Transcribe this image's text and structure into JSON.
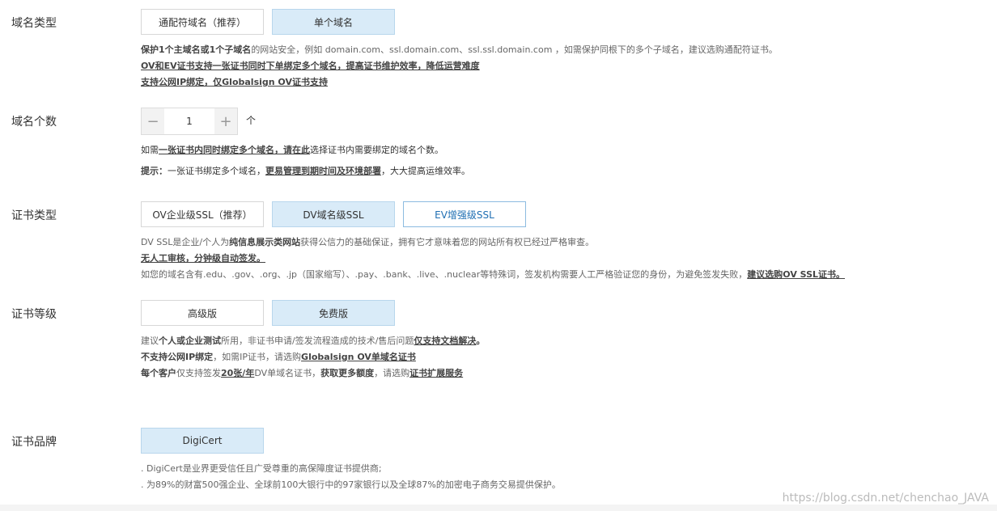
{
  "domain_type": {
    "label": "域名类型",
    "options": [
      "通配符域名（推荐）",
      "单个域名"
    ],
    "selected": "单个域名",
    "desc": {
      "line1_b1": "保护1个主域名或1个子域名",
      "line1_rest": "的网站安全，例如 domain.com、ssl.domain.com、ssl.ssl.domain.com ，如需保护同根下的多个子域名，建议选购通配符证书。",
      "line2": "OV和EV证书支持一张证书同时下单绑定多个域名，提高证书维护效率，降低运营难度",
      "line3": "支持公网IP绑定，仅Globalsign OV证书支持"
    }
  },
  "domain_count": {
    "label": "域名个数",
    "minus": "−",
    "value": "1",
    "plus": "+",
    "unit": "个",
    "desc": {
      "line1_pre": "如需",
      "line1_link": "一张证书内同时绑定多个域名，请在此",
      "line1_post": "选择证书内需要绑定的域名个数。",
      "line2_b": "提示：",
      "line2_mid": "一张证书绑定多个域名，",
      "line2_link": "更易管理到期时间及环境部署",
      "line2_post": "，大大提高运维效率。"
    }
  },
  "cert_type": {
    "label": "证书类型",
    "options": [
      "OV企业级SSL（推荐）",
      "DV域名级SSL",
      "EV增强级SSL"
    ],
    "selected": "DV域名级SSL",
    "desc": {
      "line1_pre": "DV SSL是企业/个人为",
      "line1_b": "纯信息展示类网站",
      "line1_post": "获得公信力的基础保证，拥有它才意味着您的网站所有权已经过严格审查。",
      "line2": "无人工审核，分钟级自动签发。",
      "line3_pre": "如您的域名含有.edu、.gov、.org、.jp（国家缩写）、.pay、.bank、.live、.nuclear等特殊词，签发机构需要人工严格验证您的身份，为避免签发失败，",
      "line3_link": "建议选购OV SSL证书。"
    }
  },
  "cert_level": {
    "label": "证书等级",
    "options": [
      "高级版",
      "免费版"
    ],
    "selected": "免费版",
    "desc": {
      "line1_pre": "建议",
      "line1_b": "个人或企业测试",
      "line1_mid": "所用，非证书申请/签发流程造成的技术/售后问题",
      "line1_link": "仅支持文档解决",
      "line1_post": "。",
      "line2_b": "不支持公网IP绑定",
      "line2_mid": "，如需IP证书，请选购",
      "line2_link": "Globalsign OV单域名证书",
      "line3_b": "每个客户",
      "line3_mid": "仅支持签发",
      "line3_link": "20张/年",
      "line3_mid2": "DV单域名证书，",
      "line3_b2": "获取更多额度",
      "line3_mid3": "，请选购",
      "line3_link2": "证书扩展服务"
    }
  },
  "cert_brand": {
    "label": "证书品牌",
    "options": [
      "DigiCert"
    ],
    "selected": "DigiCert",
    "desc": {
      "line1": ". DigiCert是业界更受信任且广受尊重的高保障度证书提供商;",
      "line2": ". 为89%的财富500强企业、全球前100大银行中的97家银行以及全球87%的加密电子商务交易提供保护。"
    }
  },
  "watermark": "https://blog.csdn.net/chenchao_JAVA"
}
